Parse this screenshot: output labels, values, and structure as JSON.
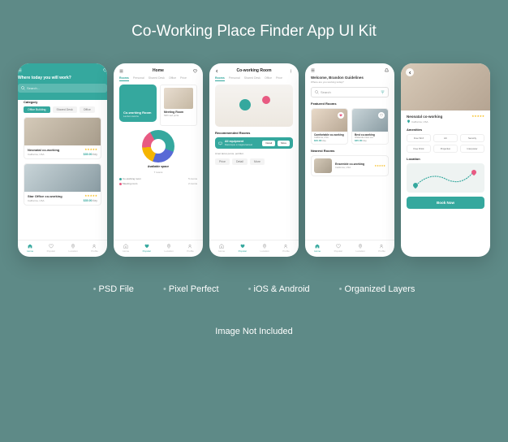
{
  "title": "Co-Working Place Finder App UI Kit",
  "features": [
    "PSD File",
    "Pixel Perfect",
    "iOS & Android",
    "Organized Layers"
  ],
  "footer": "Image Not Included",
  "colors": {
    "primary": "#35a89e",
    "accent_blue": "#5869d6",
    "accent_yellow": "#f5b500",
    "accent_pink": "#e85a82"
  },
  "nav": {
    "home": "Home",
    "popular": "Popular",
    "location": "Location",
    "profile": "Profile"
  },
  "screen1": {
    "prompt": "Where today you will work?",
    "search_placeholder": "Search...",
    "category_label": "Category",
    "chips": [
      "Office Building",
      "Shared Desk",
      "Office"
    ],
    "cards": [
      {
        "title": "Neonatal co-working",
        "subtitle": "California, USA",
        "rating": "★★★★★",
        "price": "$35.00",
        "unit": "/day"
      },
      {
        "title": "Star Office co-working",
        "subtitle": "California, USA",
        "rating": "★★★★★",
        "price": "$35.00",
        "unit": "/day"
      }
    ]
  },
  "screen2": {
    "title": "Home",
    "tabs": [
      "Rooms",
      "Personal",
      "Shared Desk",
      "Office",
      "Price"
    ],
    "feature": {
      "title": "Co-working Room",
      "subtitle": "Lectus viverra"
    },
    "feature2": {
      "title": "Meeting Room",
      "subtitle": "Nibh sed porta"
    },
    "available_label": "Available space",
    "available_count": "7 rooms",
    "legend": [
      "Co-working room",
      "Meeting room"
    ],
    "legend_counts": [
      "5 rooms",
      "2 rooms"
    ]
  },
  "screen3": {
    "title": "Co-working Room",
    "tabs": [
      "Rooms",
      "Personal",
      "Shared Desk",
      "Office",
      "Price"
    ],
    "recommended_label": "Recommended Rooms",
    "equip": {
      "title": "All equipment",
      "subtitle": "Daremque a magna laoreet"
    },
    "buttons": [
      "Detail",
      "More"
    ],
    "desc": "Amet lacus purus, porttitor.",
    "filter_chips": [
      "Price",
      "Detail",
      "More"
    ]
  },
  "screen4": {
    "welcome": "Welcome, Brandon Guidelines",
    "prompt": "Where are you working today?",
    "search_placeholder": "Search",
    "featured_label": "Featured Rooms",
    "featured": [
      {
        "title": "Comfortable co-working",
        "subtitle": "California, USA",
        "price": "$40.00",
        "unit": "/day"
      },
      {
        "title": "Best co-working",
        "subtitle": "Wakanda ordoo ora",
        "price": "$35.00",
        "unit": "/day"
      }
    ],
    "nearest_label": "Nearest Rooms",
    "nearest": {
      "title": "Ensemble co-working",
      "subtitle": "California, USA",
      "rating": "★★★★★"
    }
  },
  "screen5": {
    "title": "Neonatal co-working",
    "location": "California, USA",
    "rating": "★★★★★",
    "amenities_label": "Amenities",
    "amenities": [
      "Free Wi-fi",
      "AC",
      "Security",
      "Free Drink",
      "Projection",
      "Interpreter"
    ],
    "location_label": "Location",
    "book": "Book Now"
  }
}
